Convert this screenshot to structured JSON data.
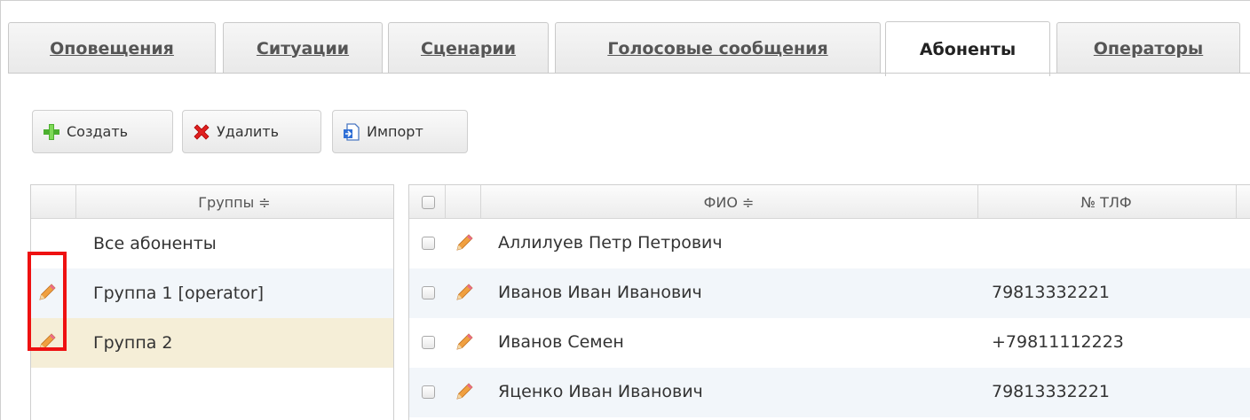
{
  "tabs": [
    {
      "label": "Оповещения",
      "active": false
    },
    {
      "label": "Ситуации",
      "active": false
    },
    {
      "label": "Сценарии",
      "active": false
    },
    {
      "label": "Голосовые сообщения",
      "active": false
    },
    {
      "label": "Абоненты",
      "active": true
    },
    {
      "label": "Операторы",
      "active": false
    }
  ],
  "toolbar": {
    "create_label": "Создать",
    "delete_label": "Удалить",
    "import_label": "Импорт"
  },
  "groups": {
    "header": "Группы ≑",
    "rows": [
      {
        "label": "Все абоненты",
        "editable": false,
        "state": "normal"
      },
      {
        "label": "Группа 1 [operator]",
        "editable": true,
        "state": "alt"
      },
      {
        "label": "Группа 2",
        "editable": true,
        "state": "selected"
      }
    ]
  },
  "subscribers": {
    "header_fio": "ФИО ≑",
    "header_phone": "№ ТЛФ",
    "rows": [
      {
        "fio": "Аллилуев Петр Петрович",
        "phone": ""
      },
      {
        "fio": "Иванов Иван Иванович",
        "phone": "79813332221"
      },
      {
        "fio": "Иванов Семен",
        "phone": "+79811112223"
      },
      {
        "fio": "Яценко Иван Иванович",
        "phone": "79813332221"
      }
    ]
  },
  "colors": {
    "highlight": "#ee1111",
    "selected_row": "#f5eed7",
    "alt_row": "#f2f6fa"
  },
  "icons": {
    "create": "green-plus-icon",
    "delete": "red-x-icon",
    "import": "document-import-icon",
    "edit": "pencil-icon"
  }
}
